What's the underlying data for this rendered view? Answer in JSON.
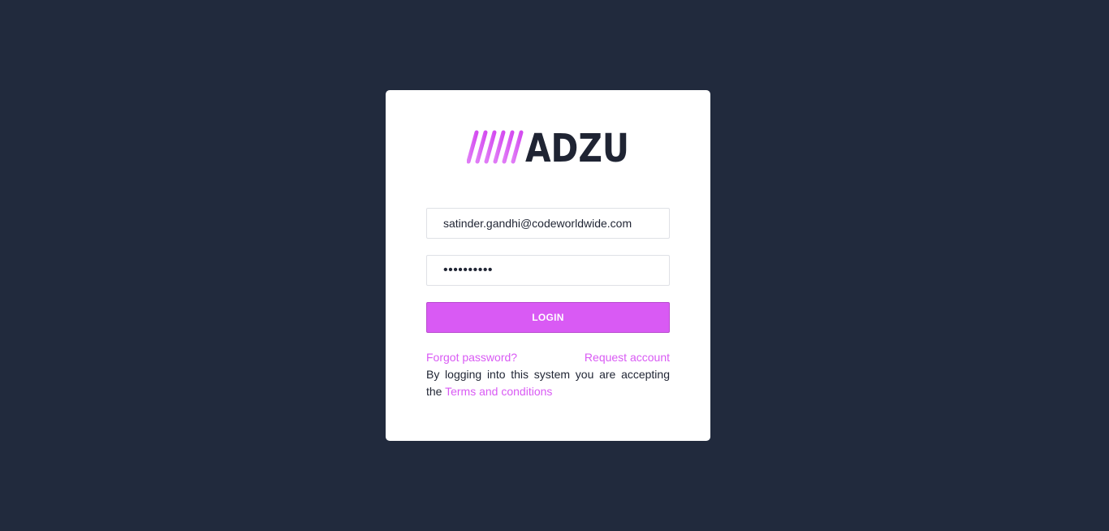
{
  "brand": {
    "logo_text": "ADZU",
    "accent_color": "#d95af4",
    "dark_color": "#1f2433"
  },
  "form": {
    "email_value": "satinder.gandhi@codeworldwide.com",
    "password_value": "••••••••••",
    "login_label": "LOGIN"
  },
  "links": {
    "forgot_password": "Forgot password?",
    "request_account": "Request account"
  },
  "notice": {
    "text": "By logging into this system you are accepting the",
    "terms_link": "Terms and conditions"
  }
}
